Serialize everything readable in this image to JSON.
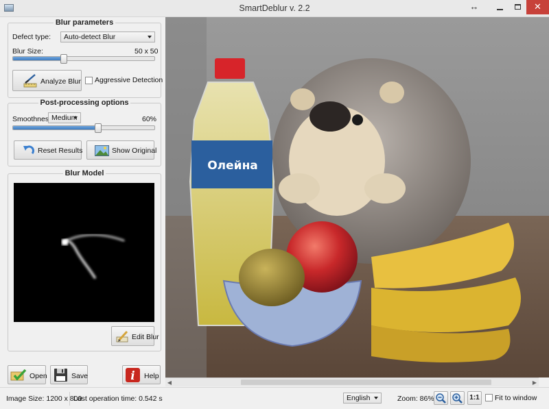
{
  "window": {
    "title": "SmartDeblur v. 2.2"
  },
  "blur_parameters": {
    "title": "Blur parameters",
    "defect_type_label": "Defect type:",
    "defect_type_value": "Auto-detect Blur",
    "blur_size_label": "Blur Size:",
    "blur_size_value": "50 x 50",
    "blur_size_fraction": 0.36,
    "analyze_button": "Analyze Blur",
    "aggressive_label": "Aggressive Detection",
    "aggressive_checked": false
  },
  "post_processing": {
    "title": "Post-processing options",
    "smoothness_label": "Smoothness:",
    "smoothness_value": "Medium",
    "smoothness_percent_text": "60%",
    "smoothness_fraction": 0.6,
    "reset_button": "Reset Results",
    "show_original_button": "Show Original"
  },
  "blur_model": {
    "title": "Blur Model",
    "edit_button": "Edit Blur"
  },
  "bottom_buttons": {
    "open": "Open",
    "save": "Save",
    "help": "Help"
  },
  "status": {
    "image_size": "Image Size: 1200 x 800",
    "last_operation": "Last operation time: 0.542 s",
    "language": "English",
    "zoom": "Zoom: 86%",
    "zoom_fit_label": "1:1",
    "fit_to_window": "Fit to window",
    "fit_checked": false
  },
  "colors": {
    "accent_blue": "#3f7cc0",
    "close_red": "#c7413a"
  }
}
